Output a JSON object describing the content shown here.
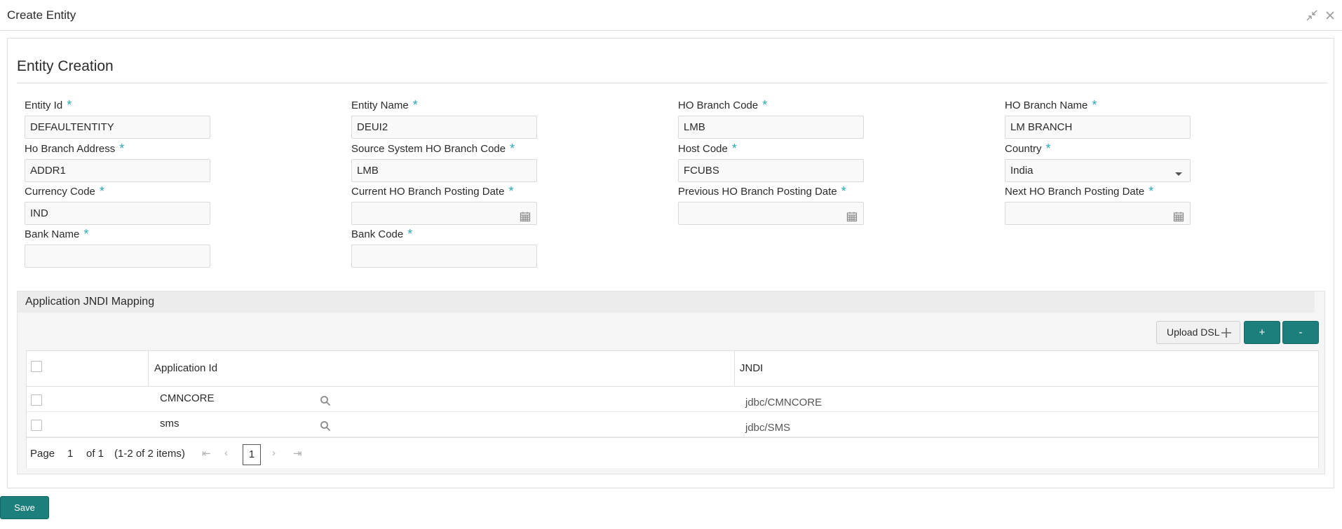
{
  "window": {
    "title": "Create Entity"
  },
  "form": {
    "section_title": "Entity Creation",
    "fields": {
      "entity_id": {
        "label": "Entity Id",
        "value": "DEFAULTENTITY"
      },
      "entity_name": {
        "label": "Entity Name",
        "value": "DEUI2"
      },
      "ho_branch_code": {
        "label": "HO Branch Code",
        "value": "LMB"
      },
      "ho_branch_name": {
        "label": "HO Branch Name",
        "value": "LM BRANCH"
      },
      "ho_branch_address": {
        "label": "Ho Branch Address",
        "value": "ADDR1"
      },
      "source_system_ho_branch_code": {
        "label": "Source System HO Branch Code",
        "value": "LMB"
      },
      "host_code": {
        "label": "Host Code",
        "value": "FCUBS"
      },
      "country": {
        "label": "Country",
        "value": "India"
      },
      "currency_code": {
        "label": "Currency Code",
        "value": "IND"
      },
      "current_ho_branch_posting_date": {
        "label": "Current HO Branch Posting Date",
        "value": ""
      },
      "previous_ho_branch_posting_date": {
        "label": "Previous HO Branch Posting Date",
        "value": ""
      },
      "next_ho_branch_posting_date": {
        "label": "Next HO Branch Posting Date",
        "value": ""
      },
      "bank_name": {
        "label": "Bank Name",
        "value": ""
      },
      "bank_code": {
        "label": "Bank Code",
        "value": ""
      }
    },
    "required_marker": "*"
  },
  "jndi_mapping": {
    "title": "Application JNDI Mapping",
    "upload_label": "Upload DSL",
    "add_label": "+",
    "remove_label": "-",
    "columns": {
      "application_id": "Application Id",
      "jndi": "JNDI"
    },
    "rows": [
      {
        "application_id": "CMNCORE",
        "jndi": "jdbc/CMNCORE"
      },
      {
        "application_id": "sms",
        "jndi": "jdbc/SMS"
      }
    ],
    "pager": {
      "page_label": "Page",
      "page_value": "1",
      "of_label": "of 1",
      "items_label": "(1-2 of 2 items)",
      "current_page": "1"
    }
  },
  "actions": {
    "save_label": "Save"
  },
  "colors": {
    "accent": "#1d7f7b",
    "required": "#2aa8b8"
  }
}
